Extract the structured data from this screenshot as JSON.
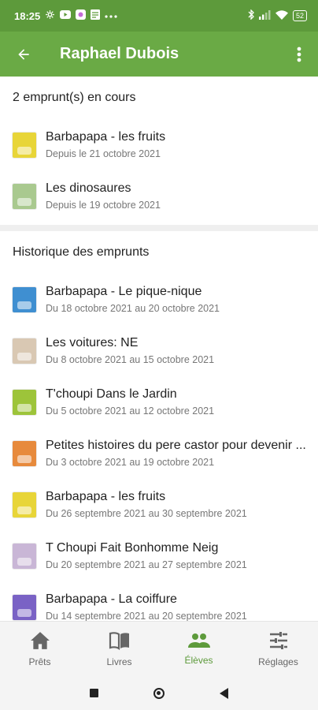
{
  "status_bar": {
    "time": "18:25",
    "battery": "52",
    "icons": [
      "settings-icon",
      "youtube-icon",
      "app-icon",
      "notes-icon",
      "more-dots-icon",
      "bluetooth-icon",
      "signal-icon",
      "wifi-icon",
      "battery-icon"
    ]
  },
  "app_bar": {
    "title": "Raphael Dubois"
  },
  "current": {
    "header": "2 emprunt(s) en cours",
    "items": [
      {
        "title": "Barbapapa - les fruits",
        "sub": "Depuis le 21 octobre 2021",
        "color": "#e8d538"
      },
      {
        "title": "Les dinosaures",
        "sub": "Depuis le 19 octobre 2021",
        "color": "#a9c98f"
      }
    ]
  },
  "history": {
    "header": "Historique des emprunts",
    "items": [
      {
        "title": "Barbapapa - Le pique-nique",
        "sub": "Du 18 octobre 2021 au 20 octobre 2021",
        "color": "#3f8fd1"
      },
      {
        "title": "Les voitures: NE",
        "sub": "Du 8 octobre 2021 au 15 octobre 2021",
        "color": "#d9c8b3"
      },
      {
        "title": "T'choupi Dans le Jardin",
        "sub": "Du 5 octobre 2021 au 12 octobre 2021",
        "color": "#9dc43a"
      },
      {
        "title": "Petites histoires du pere castor pour devenir ...",
        "sub": "Du 3 octobre 2021 au 19 octobre 2021",
        "color": "#e78a3c"
      },
      {
        "title": "Barbapapa - les fruits",
        "sub": "Du 26 septembre 2021 au 30 septembre 2021",
        "color": "#e8d538"
      },
      {
        "title": "T Choupi Fait Bonhomme Neig",
        "sub": "Du 20 septembre 2021 au 27 septembre 2021",
        "color": "#c9b6d6"
      },
      {
        "title": "Barbapapa - La coiffure",
        "sub": "Du 14 septembre 2021 au 20 septembre 2021",
        "color": "#7a62c5"
      }
    ]
  },
  "bottom_nav": [
    {
      "label": "Prêts",
      "icon": "home-icon",
      "active": false
    },
    {
      "label": "Livres",
      "icon": "book-icon",
      "active": false
    },
    {
      "label": "Élèves",
      "icon": "people-icon",
      "active": true
    },
    {
      "label": "Réglages",
      "icon": "sliders-icon",
      "active": false
    }
  ],
  "colors": {
    "status_bar": "#5d9a3b",
    "app_bar": "#6aaa45",
    "accent": "#5d9a3b"
  }
}
